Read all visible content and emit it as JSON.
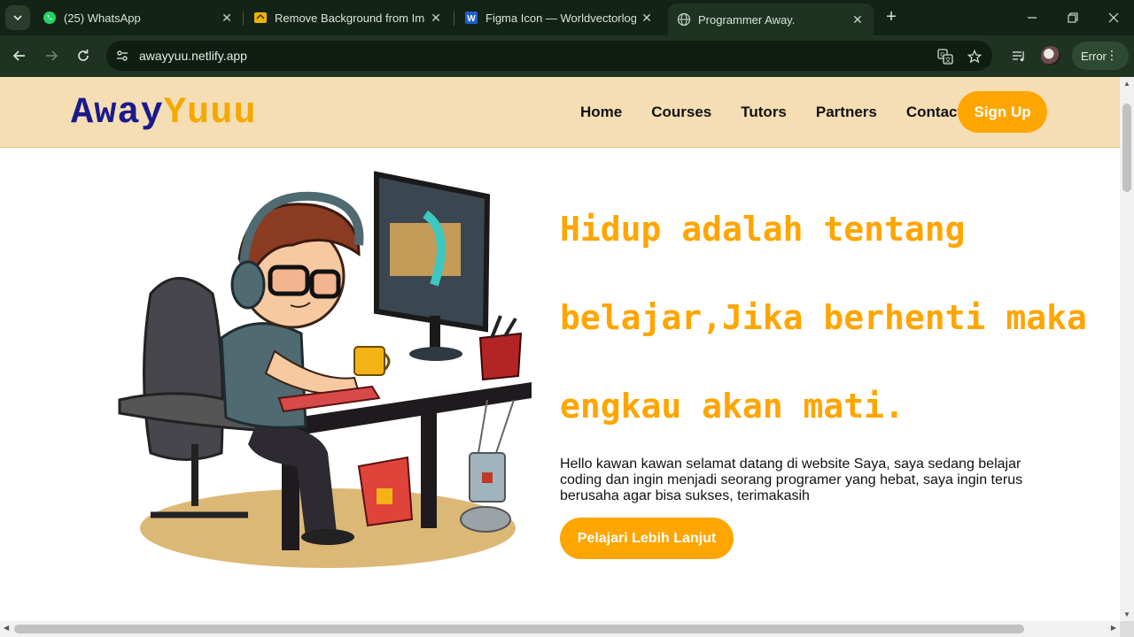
{
  "browser": {
    "tabs": [
      {
        "title": "(25) WhatsApp",
        "icon": "whatsapp-icon"
      },
      {
        "title": "Remove Background from Imag",
        "icon": "removebg-icon"
      },
      {
        "title": "Figma Icon — Worldvectorlogo",
        "icon": "word-icon"
      },
      {
        "title": "Programmer Away.",
        "icon": "globe-icon",
        "active": true
      }
    ],
    "url": "awayyuu.netlify.app",
    "error_label": "Error"
  },
  "site": {
    "logo_part1": "Away",
    "logo_part2": "Yuuu",
    "nav": [
      "Home",
      "Courses",
      "Tutors",
      "Partners",
      "Contact"
    ],
    "signup_label": "Sign Up",
    "hero_title_lines": [
      "Hidup adalah tentang",
      "belajar,Jika berhenti maka",
      "engkau akan mati."
    ],
    "hero_text": "Hello kawan kawan selamat datang di website Saya, saya sedang belajar coding dan ingin menjadi seorang programer yang hebat, saya ingin terus berusaha agar bisa sukses, terimakasih",
    "cta_label": "Pelajari Lebih Lanjut",
    "colors": {
      "accent": "#ffa500",
      "header_bg": "#f5deb3",
      "logo_blue": "#1a1a8c"
    }
  }
}
